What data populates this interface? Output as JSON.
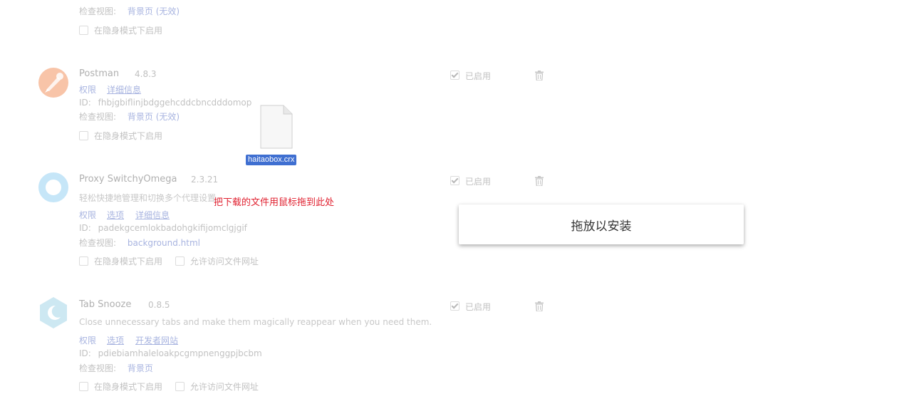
{
  "top_partial": {
    "inspect_label": "检查视图:",
    "inspect_link": "背景页 (无效)",
    "incognito": "在隐身模式下启用"
  },
  "extensions": [
    {
      "name": "Postman",
      "version": "4.8.3",
      "permissions": "权限",
      "details": "详细信息",
      "id_label": "ID:",
      "id": "fhbjgbiflinjbdggehcddcbncdddomop",
      "inspect_label": "检查视图:",
      "inspect_link": "背景页 (无效)",
      "incognito": "在隐身模式下启用",
      "enabled": "已启用"
    },
    {
      "name": "Proxy SwitchyOmega",
      "version": "2.3.21",
      "description": "轻松快捷地管理和切换多个代理设置",
      "permissions": "权限",
      "options": "选项",
      "details": "详细信息",
      "id_label": "ID:",
      "id": "padekgcemlokbadohgkifijomclgjgif",
      "inspect_label": "检查视图:",
      "inspect_link": "background.html",
      "incognito": "在隐身模式下启用",
      "file_access": "允许访问文件网址",
      "enabled": "已启用"
    },
    {
      "name": "Tab Snooze",
      "version": "0.8.5",
      "description": "Close unnecessary tabs and make them magically reappear when you need them.",
      "permissions": "权限",
      "options": "选项",
      "developer_site": "开发者网站",
      "id_label": "ID:",
      "id": "pdiebiamhaleloakpcgmpnenggpjbcbm",
      "inspect_label": "检查视图:",
      "inspect_link": "背景页",
      "incognito": "在隐身模式下启用",
      "file_access": "允许访问文件网址",
      "enabled": "已启用"
    }
  ],
  "drag": {
    "file_name": "haitaobox.crx",
    "hint": "把下载的文件用鼠标拖到此处",
    "drop_label": "拖放以安装"
  },
  "icons": {
    "postman": "postman-logo-icon",
    "switchyomega": "switchyomega-ring-icon",
    "tabsnooze": "tabsnooze-moon-icon",
    "trash": "trash-icon",
    "file": "file-document-icon"
  },
  "colors": {
    "hint_red": "#e0202f",
    "file_label_bg": "#3f6fd1",
    "postman_orange": "#f8c4a8",
    "omega_blue": "#c6e6f8",
    "snooze_blue": "#cde8f2"
  }
}
